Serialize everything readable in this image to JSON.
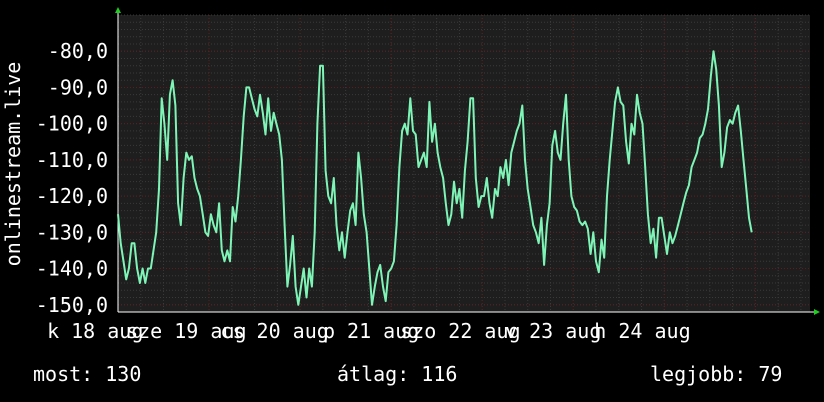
{
  "colors": {
    "background": "#000000",
    "plot_background": "#1e1e1e",
    "line": "#7ef5b7",
    "grid_minor": "#3a3a3a",
    "grid_major": "#5a1e1e",
    "axis_arrow": "#22cc22",
    "text": "#ffffff"
  },
  "stats": {
    "current": "most: 130",
    "average": "átlag: 116",
    "best": "legjobb: 79"
  },
  "chart_data": {
    "type": "line",
    "title": "",
    "ylabel": "onlinestream.live",
    "xlabel": "",
    "ylim": [
      -152,
      -70
    ],
    "yticks": [
      -80,
      -90,
      -100,
      -110,
      -120,
      -130,
      -140,
      -150
    ],
    "ytick_labels": [
      "-80,0",
      "-90,0",
      "-100,0",
      "-110,0",
      "-120,0",
      "-130,0",
      "-140,0",
      "-150,0"
    ],
    "xlim": [
      0,
      7.6
    ],
    "xtick_labels": [
      {
        "x": -0.25,
        "label": "k 18 aug"
      },
      {
        "x": 0.75,
        "label": "sze 19 aug"
      },
      {
        "x": 1.72,
        "label": "cs 20 aug"
      },
      {
        "x": 2.78,
        "label": "p 21 aug"
      },
      {
        "x": 3.76,
        "label": "szo 22 aug"
      },
      {
        "x": 4.78,
        "label": "v 23 aug"
      },
      {
        "x": 5.76,
        "label": "h 24 aug"
      }
    ],
    "series": [
      {
        "values": [
          [
            0.0,
            -125
          ],
          [
            0.03,
            -133
          ],
          [
            0.06,
            -138
          ],
          [
            0.09,
            -143
          ],
          [
            0.12,
            -140
          ],
          [
            0.15,
            -133
          ],
          [
            0.18,
            -133
          ],
          [
            0.21,
            -140
          ],
          [
            0.24,
            -144
          ],
          [
            0.27,
            -140
          ],
          [
            0.3,
            -144
          ],
          [
            0.33,
            -140
          ],
          [
            0.36,
            -140
          ],
          [
            0.39,
            -135
          ],
          [
            0.42,
            -130
          ],
          [
            0.45,
            -118
          ],
          [
            0.48,
            -93
          ],
          [
            0.51,
            -100
          ],
          [
            0.54,
            -110
          ],
          [
            0.57,
            -92
          ],
          [
            0.6,
            -88
          ],
          [
            0.63,
            -95
          ],
          [
            0.66,
            -122
          ],
          [
            0.69,
            -128
          ],
          [
            0.72,
            -115
          ],
          [
            0.75,
            -108
          ],
          [
            0.78,
            -110
          ],
          [
            0.81,
            -109
          ],
          [
            0.84,
            -115
          ],
          [
            0.87,
            -118
          ],
          [
            0.9,
            -120
          ],
          [
            0.93,
            -125
          ],
          [
            0.96,
            -130
          ],
          [
            0.99,
            -131
          ],
          [
            1.02,
            -125
          ],
          [
            1.05,
            -128
          ],
          [
            1.08,
            -130
          ],
          [
            1.11,
            -122
          ],
          [
            1.14,
            -135
          ],
          [
            1.17,
            -138
          ],
          [
            1.2,
            -135
          ],
          [
            1.23,
            -138
          ],
          [
            1.26,
            -123
          ],
          [
            1.29,
            -127
          ],
          [
            1.32,
            -120
          ],
          [
            1.35,
            -110
          ],
          [
            1.38,
            -98
          ],
          [
            1.41,
            -90
          ],
          [
            1.44,
            -90
          ],
          [
            1.47,
            -93
          ],
          [
            1.5,
            -96
          ],
          [
            1.53,
            -98
          ],
          [
            1.56,
            -92
          ],
          [
            1.59,
            -97
          ],
          [
            1.62,
            -103
          ],
          [
            1.65,
            -93
          ],
          [
            1.68,
            -102
          ],
          [
            1.71,
            -97
          ],
          [
            1.74,
            -100
          ],
          [
            1.77,
            -103
          ],
          [
            1.8,
            -110
          ],
          [
            1.83,
            -128
          ],
          [
            1.86,
            -145
          ],
          [
            1.89,
            -139
          ],
          [
            1.92,
            -131
          ],
          [
            1.95,
            -145
          ],
          [
            1.98,
            -150
          ],
          [
            2.01,
            -145
          ],
          [
            2.04,
            -140
          ],
          [
            2.07,
            -148
          ],
          [
            2.1,
            -140
          ],
          [
            2.13,
            -145
          ],
          [
            2.16,
            -130
          ],
          [
            2.19,
            -100
          ],
          [
            2.22,
            -84
          ],
          [
            2.25,
            -84
          ],
          [
            2.28,
            -113
          ],
          [
            2.31,
            -120
          ],
          [
            2.34,
            -122
          ],
          [
            2.37,
            -115
          ],
          [
            2.4,
            -128
          ],
          [
            2.43,
            -135
          ],
          [
            2.46,
            -130
          ],
          [
            2.49,
            -137
          ],
          [
            2.52,
            -130
          ],
          [
            2.55,
            -124
          ],
          [
            2.58,
            -122
          ],
          [
            2.61,
            -128
          ],
          [
            2.64,
            -108
          ],
          [
            2.67,
            -115
          ],
          [
            2.7,
            -125
          ],
          [
            2.73,
            -130
          ],
          [
            2.76,
            -140
          ],
          [
            2.79,
            -150
          ],
          [
            2.82,
            -145
          ],
          [
            2.85,
            -141
          ],
          [
            2.88,
            -139
          ],
          [
            2.91,
            -145
          ],
          [
            2.94,
            -149
          ],
          [
            2.97,
            -141
          ],
          [
            3.0,
            -140
          ],
          [
            3.03,
            -138
          ],
          [
            3.06,
            -128
          ],
          [
            3.09,
            -112
          ],
          [
            3.12,
            -102
          ],
          [
            3.15,
            -100
          ],
          [
            3.18,
            -103
          ],
          [
            3.21,
            -93
          ],
          [
            3.24,
            -102
          ],
          [
            3.27,
            -103
          ],
          [
            3.3,
            -112
          ],
          [
            3.33,
            -110
          ],
          [
            3.36,
            -108
          ],
          [
            3.39,
            -112
          ],
          [
            3.42,
            -94
          ],
          [
            3.45,
            -105
          ],
          [
            3.48,
            -100
          ],
          [
            3.51,
            -108
          ],
          [
            3.54,
            -112
          ],
          [
            3.57,
            -115
          ],
          [
            3.6,
            -122
          ],
          [
            3.63,
            -128
          ],
          [
            3.66,
            -125
          ],
          [
            3.69,
            -116
          ],
          [
            3.72,
            -122
          ],
          [
            3.75,
            -118
          ],
          [
            3.78,
            -126
          ],
          [
            3.81,
            -113
          ],
          [
            3.84,
            -105
          ],
          [
            3.87,
            -93
          ],
          [
            3.9,
            -93
          ],
          [
            3.93,
            -115
          ],
          [
            3.96,
            -123
          ],
          [
            3.99,
            -120
          ],
          [
            4.02,
            -120
          ],
          [
            4.05,
            -115
          ],
          [
            4.08,
            -122
          ],
          [
            4.11,
            -126
          ],
          [
            4.14,
            -118
          ],
          [
            4.17,
            -120
          ],
          [
            4.2,
            -112
          ],
          [
            4.23,
            -115
          ],
          [
            4.26,
            -110
          ],
          [
            4.29,
            -117
          ],
          [
            4.32,
            -108
          ],
          [
            4.35,
            -105
          ],
          [
            4.38,
            -102
          ],
          [
            4.41,
            -100
          ],
          [
            4.44,
            -95
          ],
          [
            4.47,
            -110
          ],
          [
            4.5,
            -118
          ],
          [
            4.53,
            -123
          ],
          [
            4.56,
            -128
          ],
          [
            4.59,
            -130
          ],
          [
            4.62,
            -133
          ],
          [
            4.65,
            -126
          ],
          [
            4.68,
            -139
          ],
          [
            4.71,
            -128
          ],
          [
            4.74,
            -122
          ],
          [
            4.77,
            -106
          ],
          [
            4.8,
            -102
          ],
          [
            4.83,
            -108
          ],
          [
            4.86,
            -110
          ],
          [
            4.89,
            -100
          ],
          [
            4.92,
            -92
          ],
          [
            4.95,
            -110
          ],
          [
            4.98,
            -120
          ],
          [
            5.01,
            -123
          ],
          [
            5.04,
            -124
          ],
          [
            5.07,
            -127
          ],
          [
            5.1,
            -128
          ],
          [
            5.13,
            -127
          ],
          [
            5.16,
            -129
          ],
          [
            5.19,
            -136
          ],
          [
            5.22,
            -130
          ],
          [
            5.25,
            -138
          ],
          [
            5.28,
            -141
          ],
          [
            5.31,
            -132
          ],
          [
            5.34,
            -137
          ],
          [
            5.37,
            -120
          ],
          [
            5.4,
            -110
          ],
          [
            5.43,
            -102
          ],
          [
            5.46,
            -94
          ],
          [
            5.49,
            -90
          ],
          [
            5.52,
            -94
          ],
          [
            5.55,
            -95
          ],
          [
            5.58,
            -105
          ],
          [
            5.61,
            -111
          ],
          [
            5.64,
            -100
          ],
          [
            5.67,
            -103
          ],
          [
            5.7,
            -92
          ],
          [
            5.73,
            -97
          ],
          [
            5.76,
            -100
          ],
          [
            5.79,
            -112
          ],
          [
            5.82,
            -125
          ],
          [
            5.85,
            -133
          ],
          [
            5.88,
            -129
          ],
          [
            5.91,
            -137
          ],
          [
            5.94,
            -126
          ],
          [
            5.97,
            -126
          ],
          [
            6.0,
            -131
          ],
          [
            6.03,
            -136
          ],
          [
            6.06,
            -130
          ],
          [
            6.09,
            -133
          ],
          [
            6.12,
            -131
          ],
          [
            6.15,
            -128
          ],
          [
            6.18,
            -125
          ],
          [
            6.21,
            -122
          ],
          [
            6.24,
            -119
          ],
          [
            6.27,
            -117
          ],
          [
            6.3,
            -112
          ],
          [
            6.33,
            -110
          ],
          [
            6.36,
            -108
          ],
          [
            6.39,
            -104
          ],
          [
            6.42,
            -103
          ],
          [
            6.45,
            -100
          ],
          [
            6.48,
            -96
          ],
          [
            6.51,
            -87
          ],
          [
            6.54,
            -80
          ],
          [
            6.57,
            -85
          ],
          [
            6.6,
            -95
          ],
          [
            6.63,
            -112
          ],
          [
            6.66,
            -108
          ],
          [
            6.69,
            -101
          ],
          [
            6.72,
            -99
          ],
          [
            6.75,
            -100
          ],
          [
            6.78,
            -97
          ],
          [
            6.81,
            -95
          ],
          [
            6.84,
            -102
          ],
          [
            6.87,
            -110
          ],
          [
            6.9,
            -118
          ],
          [
            6.93,
            -126
          ],
          [
            6.96,
            -130
          ]
        ]
      }
    ]
  }
}
